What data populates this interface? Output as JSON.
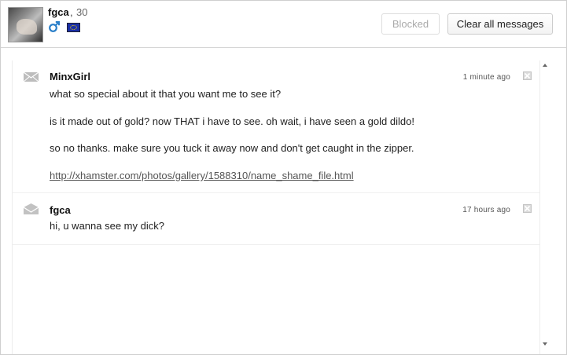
{
  "header": {
    "username": "fgca",
    "age_separator": ",",
    "age": "30",
    "gender_icon": "male-symbol-icon",
    "flag_icon": "eu-flag-icon",
    "blocked_label": "Blocked",
    "clear_label": "Clear all messages"
  },
  "messages": [
    {
      "sender": "MinxGirl",
      "time": "1 minute ago",
      "icon": "envelope-icon",
      "lines": [
        "what so special about it that you want me to see it?",
        "is it made out of gold? now THAT i have to see. oh wait, i have seen a gold dildo!",
        "so no thanks. make sure you tuck it away now and don't get caught in the zipper."
      ],
      "link": "http://xhamster.com/photos/gallery/1588310/name_shame_file.html"
    },
    {
      "sender": "fgca",
      "time": "17 hours ago",
      "icon": "envelope-open-icon",
      "lines": [
        "hi, u wanna see my dick?"
      ]
    }
  ],
  "colors": {
    "link": "#555555",
    "male_symbol": "#2a7fc9",
    "flag_blue": "#1a2fa6"
  }
}
